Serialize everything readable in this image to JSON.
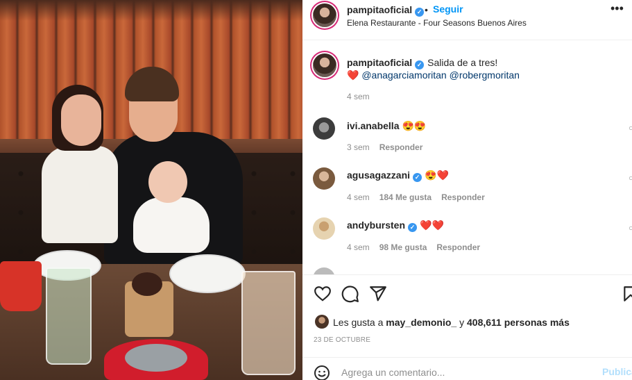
{
  "post": {
    "username": "pampitaoficial",
    "follow_label": "Seguir",
    "separator": "•",
    "location": "Elena Restaurante - Four Seasons Buenos Aires",
    "more_label": "•••"
  },
  "caption": {
    "username": "pampitaoficial",
    "text": "Salida de a tres!",
    "heart": "❤️",
    "mentions": "@anagarciamoritan @robergmoritan",
    "time": "4 sem"
  },
  "comments": [
    {
      "username": "ivi.anabella",
      "verified": false,
      "text": "😍😍",
      "time": "3 sem",
      "likes": "",
      "reply": "Responder"
    },
    {
      "username": "agusagazzani",
      "verified": true,
      "text": "😍❤️",
      "time": "4 sem",
      "likes": "184 Me gusta",
      "reply": "Responder"
    },
    {
      "username": "andybursten",
      "verified": true,
      "text": "❤️❤️",
      "time": "4 sem",
      "likes": "98 Me gusta",
      "reply": "Responder"
    }
  ],
  "likes": {
    "prefix": "Les gusta a",
    "user": "may_demonio_",
    "middle": "y",
    "count": "408,611 personas más"
  },
  "date": "23 DE OCTUBRE",
  "comment_box": {
    "placeholder": "Agrega un comentario...",
    "publish_label": "Publicar"
  },
  "icons": [
    "heart-icon",
    "comment-icon",
    "share-icon",
    "bookmark-icon",
    "emoji-icon",
    "more-icon",
    "verified-icon"
  ],
  "colors": {
    "accent": "#0095f6",
    "verified": "#3897f0",
    "publish_disabled": "#b2dffc",
    "muted": "#8e8e8e"
  }
}
